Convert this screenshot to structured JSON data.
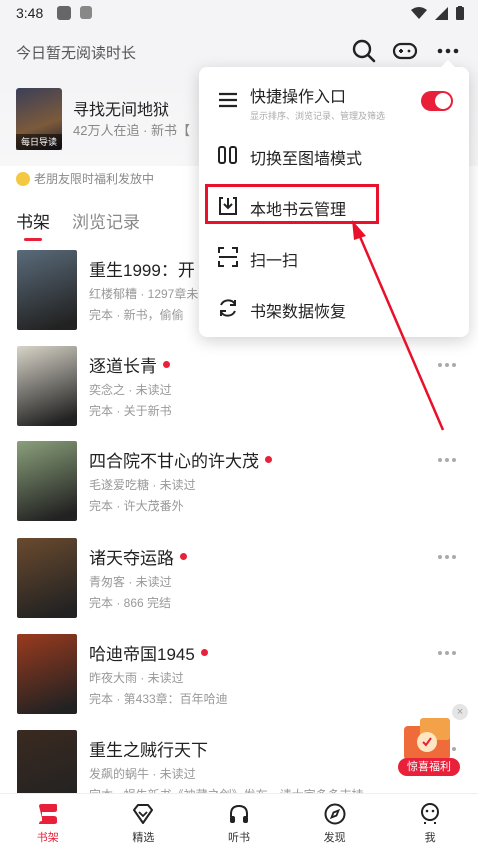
{
  "status_bar": {
    "time": "3:48"
  },
  "header": {
    "read_time": "今日暂无阅读时长",
    "search_icon": "search-icon",
    "game_icon": "gamepad-icon",
    "more_icon": "more-icon"
  },
  "promo": {
    "cover_tag": "每日导读",
    "title": "寻找无间地狱",
    "meta": "42万人在追 · 新书【"
  },
  "notice": "老朋友限时福利发放中",
  "tabs": [
    "书架",
    "浏览记录"
  ],
  "books": [
    {
      "title": "重生1999：开",
      "line1": "红楼郁糟 · 1297章未",
      "line2": "完本 · 新书，偷偷",
      "has_dot": false,
      "cover_color": "#5a6b7a"
    },
    {
      "title": "逐道长青",
      "line1": "奕念之 · 未读过",
      "line2": "完本 · 关于新书",
      "has_dot": true,
      "cover_color": "#d8d4c8"
    },
    {
      "title": "四合院不甘心的许大茂",
      "line1": "毛遂爱吃糖 · 未读过",
      "line2": "完本 · 许大茂番外",
      "has_dot": true,
      "cover_color": "#8aa07a"
    },
    {
      "title": "诸天夺运路",
      "line1": "青匆客 · 未读过",
      "line2": "完本 · 866 完结",
      "has_dot": true,
      "cover_color": "#6a4a2e"
    },
    {
      "title": "哈迪帝国1945",
      "line1": "昨夜大雨 · 未读过",
      "line2": "完本 · 第433章：百年哈迪",
      "has_dot": true,
      "cover_color": "#9a3a1e"
    },
    {
      "title": "重生之贼行天下",
      "line1": "发飙的蜗牛 · 未读过",
      "line2": "完本 · 蜗牛新书《神藏之剑》发布，请大家多多支持",
      "has_dot": false,
      "cover_color": "#3a2a20"
    }
  ],
  "gift": {
    "label": "惊喜福利",
    "close": "×"
  },
  "bottom_nav": [
    {
      "label": "书架",
      "icon": "bookshelf-icon",
      "active": true
    },
    {
      "label": "精选",
      "icon": "diamond-icon",
      "active": false
    },
    {
      "label": "听书",
      "icon": "headphones-icon",
      "active": false
    },
    {
      "label": "发现",
      "icon": "compass-icon",
      "active": false
    },
    {
      "label": "我",
      "icon": "profile-icon",
      "active": false
    }
  ],
  "menu": {
    "items": [
      {
        "label": "快捷操作入口",
        "sub": "显示排序、浏览记录、管理及筛选",
        "icon": "menu-lines-icon"
      },
      {
        "label": "切换至图墙模式",
        "icon": "grid-view-icon"
      },
      {
        "label": "本地书云管理",
        "icon": "download-icon"
      },
      {
        "label": "扫一扫",
        "icon": "scan-icon"
      },
      {
        "label": "书架数据恢复",
        "icon": "restore-icon"
      }
    ]
  },
  "colors": {
    "accent": "#e8203a",
    "highlight": "#e8102a"
  }
}
